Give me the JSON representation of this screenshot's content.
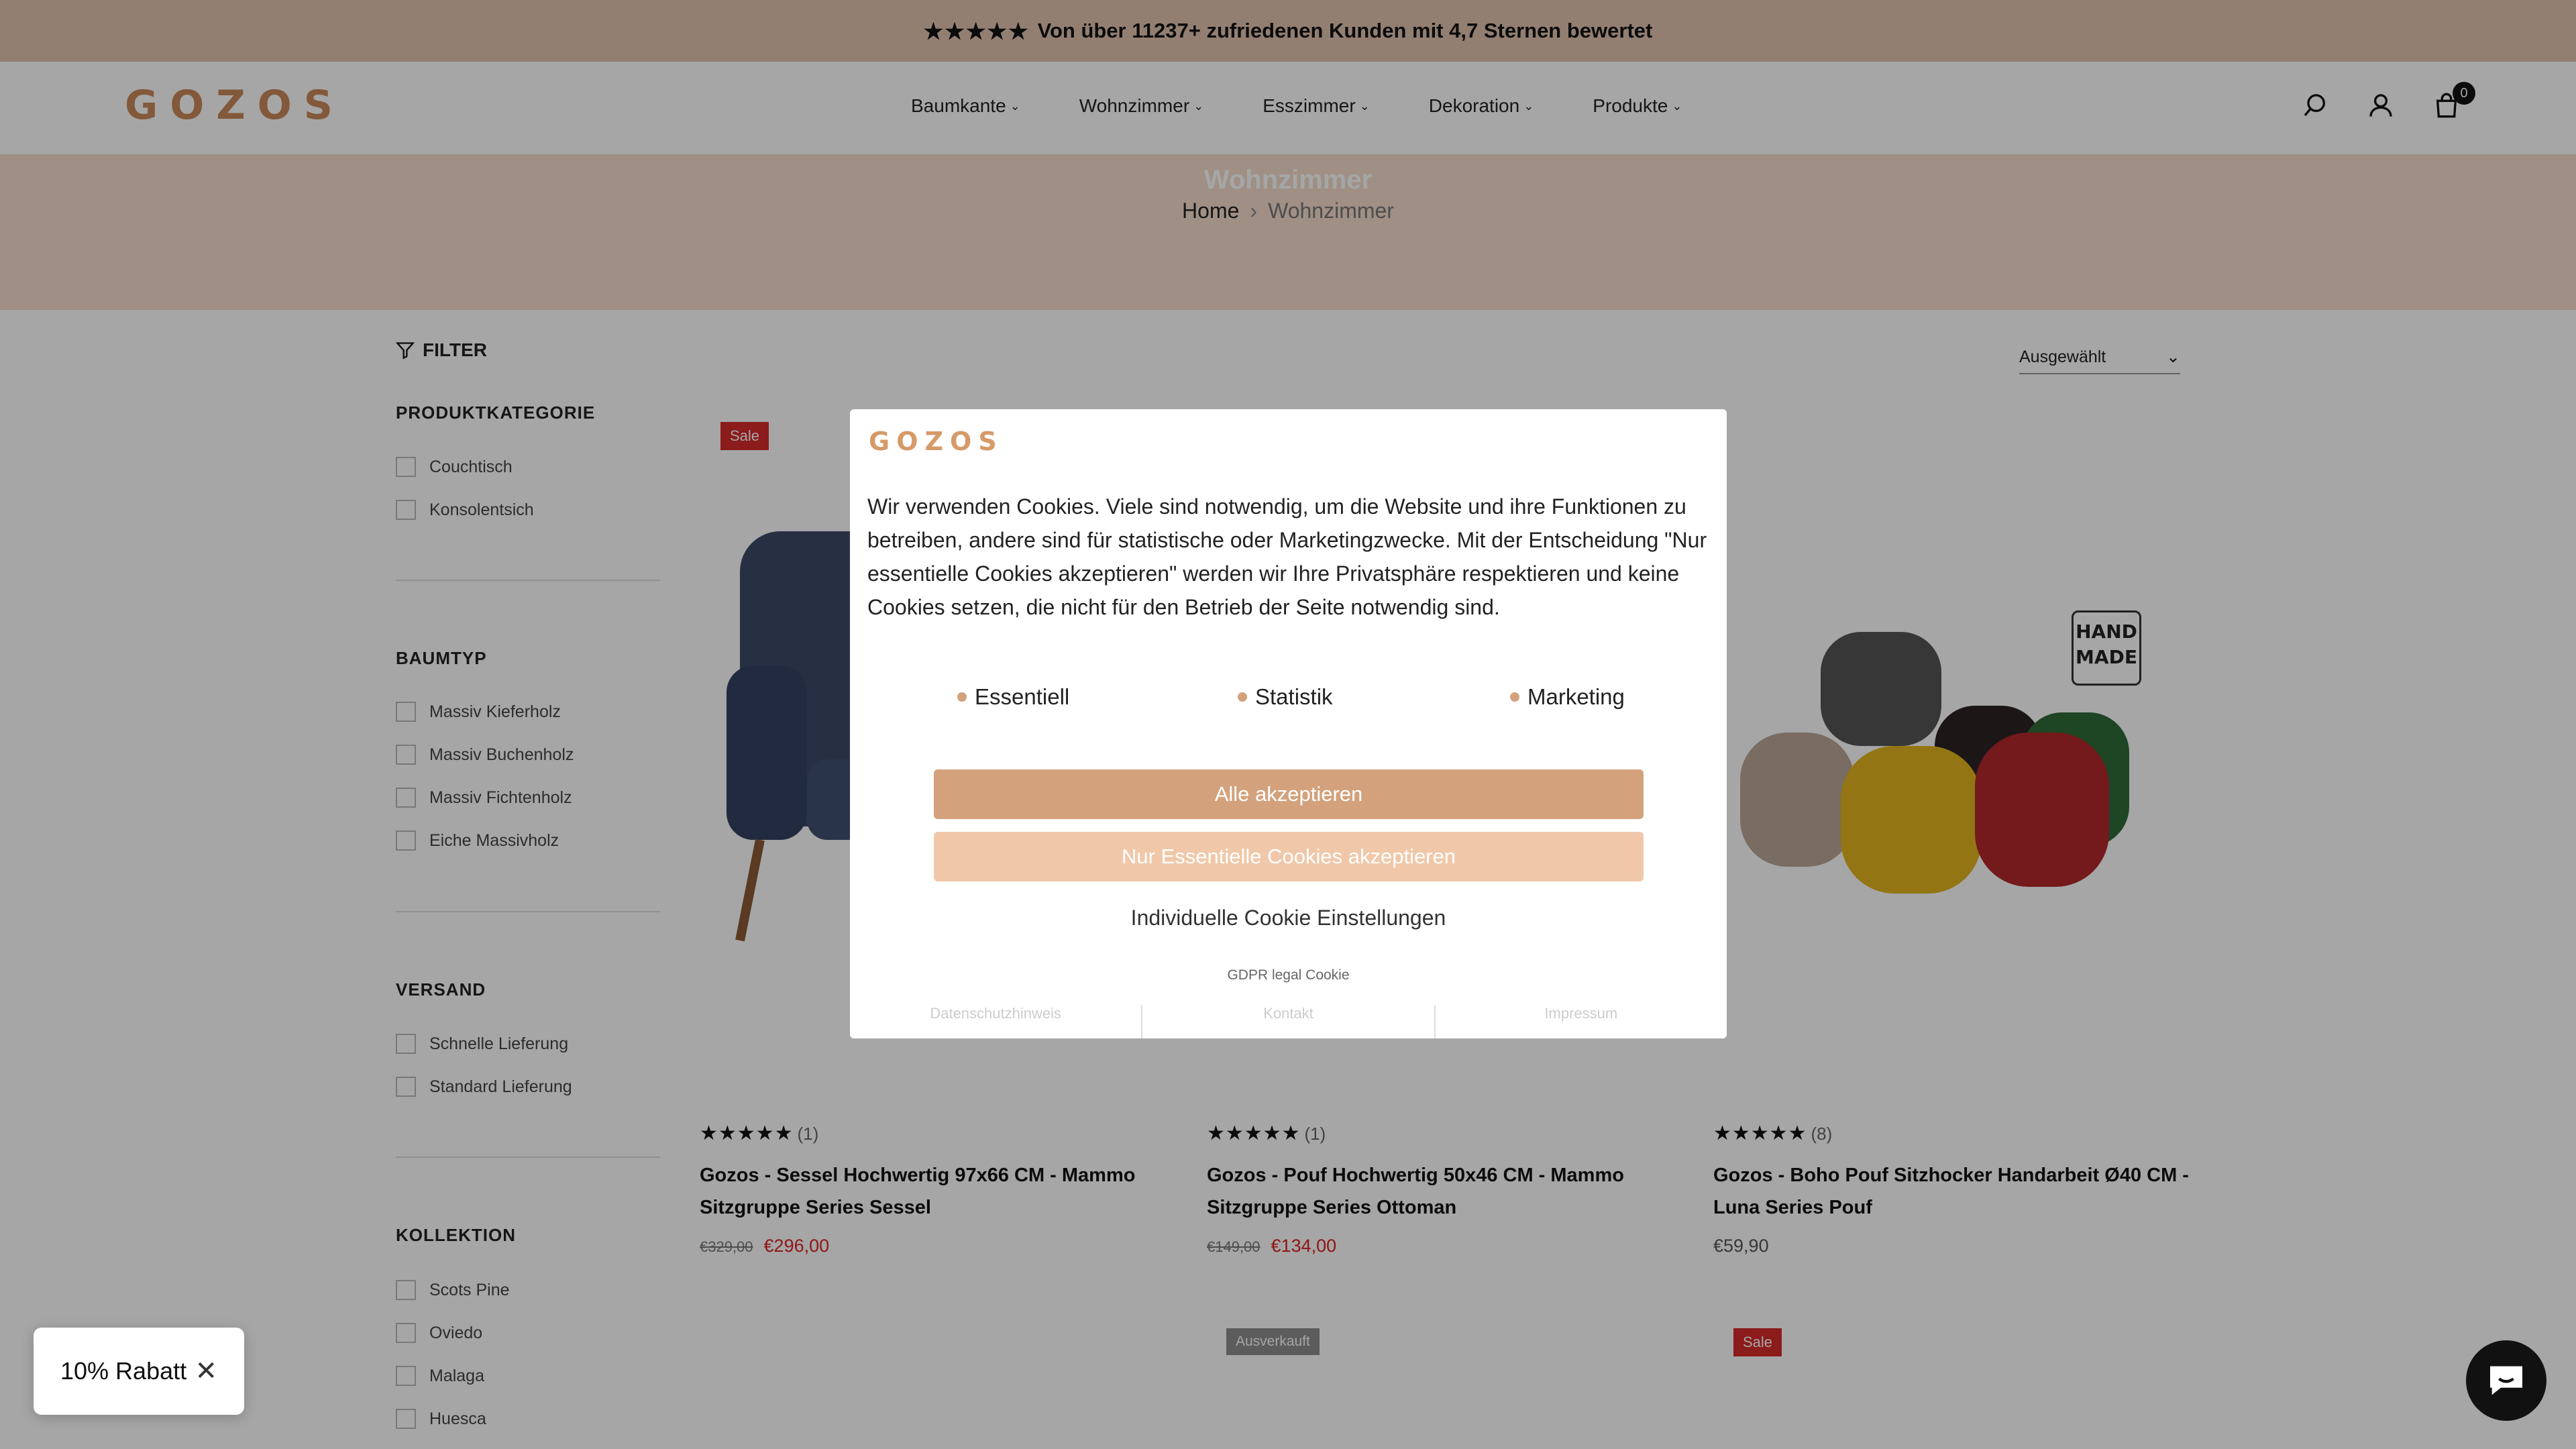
{
  "announcement": {
    "stars": "★★★★★",
    "text": "Von über 11237+ zufriedenen Kunden mit 4,7 Sternen bewertet"
  },
  "header": {
    "logo": "GOZOS",
    "nav": [
      {
        "label": "Baumkante"
      },
      {
        "label": "Wohnzimmer"
      },
      {
        "label": "Esszimmer"
      },
      {
        "label": "Dekoration"
      },
      {
        "label": "Produkte"
      }
    ],
    "cart_count": "0",
    "icons": [
      "search-icon",
      "account-icon",
      "cart-icon"
    ]
  },
  "hero": {
    "title": "Wohnzimmer",
    "breadcrumb": {
      "home": "Home",
      "current": "Wohnzimmer"
    }
  },
  "sidebar": {
    "filter_label": "FILTER",
    "sections": [
      {
        "title": "PRODUKTKATEGORIE",
        "items": [
          "Couchtisch",
          "Konsolentsich"
        ]
      },
      {
        "title": "BAUMTYP",
        "items": [
          "Massiv Kieferholz",
          "Massiv Buchenholz",
          "Massiv Fichtenholz",
          "Eiche Massivholz"
        ]
      },
      {
        "title": "VERSAND",
        "items": [
          "Schnelle Lieferung",
          "Standard Lieferung"
        ]
      },
      {
        "title": "KOLLEKTION",
        "items": [
          "Scots Pine",
          "Oviedo",
          "Malaga",
          "Huesca"
        ]
      }
    ]
  },
  "sort": {
    "selected": "Ausgewählt"
  },
  "products": [
    {
      "badge": "Sale",
      "stars": "★★★★★",
      "count": "(1)",
      "title": "Gozos - Sessel Hochwertig 97x66 CM - Mammo Sitzgruppe Series Sessel",
      "old_price": "€329,00",
      "price": "€296,00"
    },
    {
      "badge": "",
      "stars": "★★★★★",
      "count": "(1)",
      "title": "Gozos - Pouf Hochwertig 50x46 CM - Mammo Sitzgruppe Series Ottoman",
      "old_price": "€149,00",
      "price": "€134,00"
    },
    {
      "badge": "",
      "stars": "★★★★★",
      "count": "(8)",
      "title": "Gozos - Boho Pouf Sitzhocker Handarbeit Ø40 CM - Luna Series Pouf",
      "old_price": "",
      "price": "€59,90",
      "handmade_label": "HAND MADE"
    }
  ],
  "row2_badges": [
    "Ausverkauft",
    "Sale"
  ],
  "cookie": {
    "logo": "GOZOS",
    "text": "Wir verwenden Cookies. Viele sind notwendig, um die Website und ihre Funktionen zu betreiben, andere sind für statistische oder Marketingzwecke. Mit der Entscheidung \"Nur essentielle Cookies akzeptieren\" werden wir Ihre Privatsphäre respektieren und keine Cookies setzen, die nicht für den Betrieb der Seite notwendig sind.",
    "options": [
      "Essentiell",
      "Statistik",
      "Marketing"
    ],
    "accept_all": "Alle akzeptieren",
    "accept_essential": "Nur Essentielle Cookies akzeptieren",
    "individual": "Individuelle Cookie Einstellungen",
    "gdpr": "GDPR legal Cookie",
    "links": [
      "Datenschutzhinweis",
      "Kontakt",
      "Impressum"
    ]
  },
  "discount": {
    "label": "10% Rabatt"
  },
  "colors": {
    "brand": "#c8895a",
    "topbar": "#e2c4b0",
    "hero": "#f4dccc",
    "sale": "#d82a2a",
    "button": "#d3a27c",
    "button_light": "#f0c8a9"
  }
}
